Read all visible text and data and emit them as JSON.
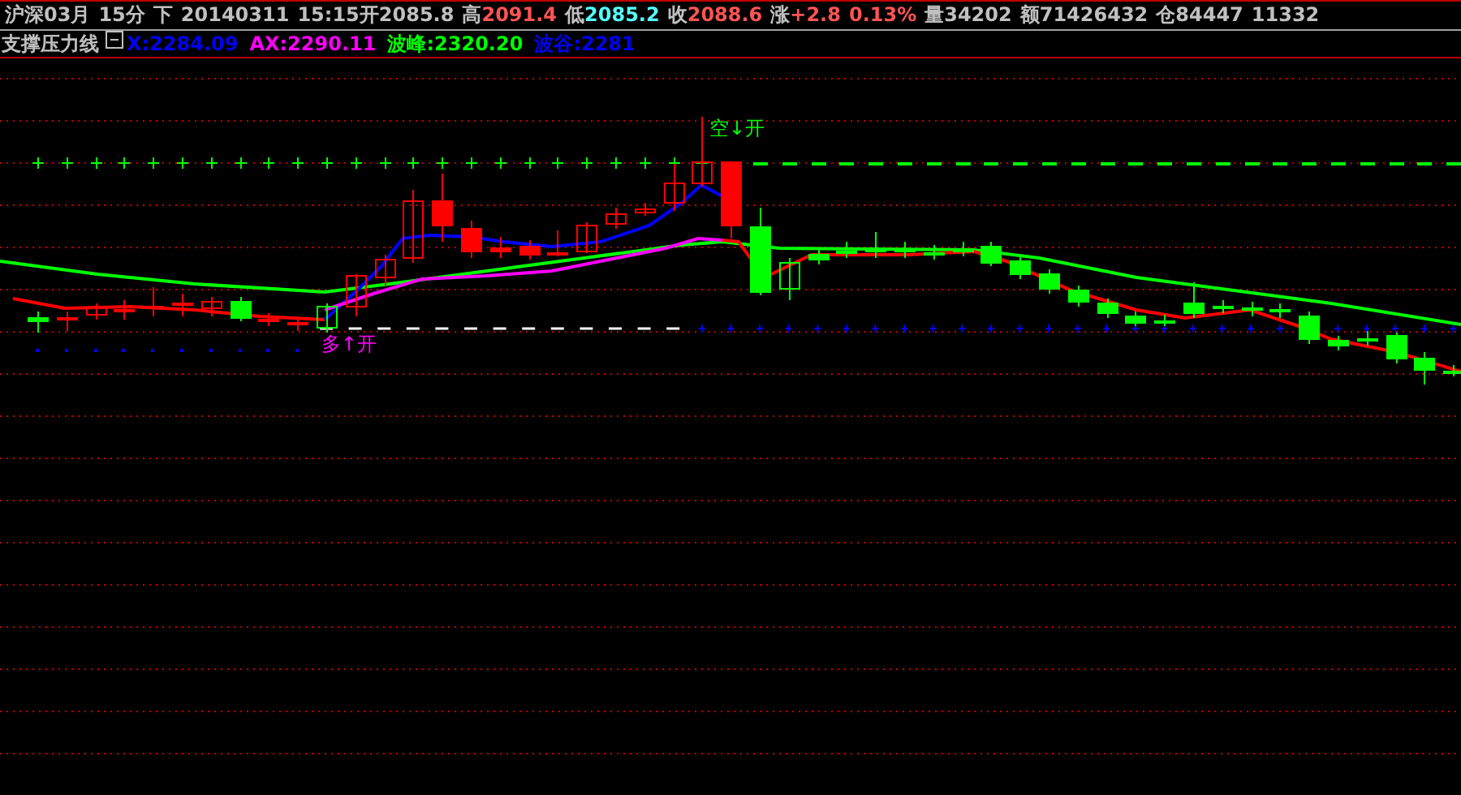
{
  "quote_bar": {
    "info": [
      "沪深03月",
      "15分",
      "下",
      "20140311",
      "15:15开2085.8"
    ],
    "quotes": [
      {
        "label": "高",
        "value": "2091.4",
        "rising": true
      },
      {
        "label": "低",
        "value": "2085.2",
        "rising": false
      },
      {
        "label": "收",
        "value": "2088.6",
        "rising": true
      },
      {
        "label": "涨",
        "value": "+2.8",
        "rising": true
      }
    ],
    "change": {
      "value": "0.13%",
      "rising": true
    },
    "extra": [
      "量34202",
      "额71426432",
      "仓84447",
      "11332"
    ]
  },
  "indicator": {
    "title": "支撑压力线",
    "collapsed": false,
    "series": [
      {
        "text": "X:2284.09"
      },
      {
        "text": "AX:2290.11"
      },
      {
        "text": "波峰:2320.20"
      },
      {
        "text": "波谷:2281"
      }
    ]
  },
  "chart": {
    "signals": [
      {
        "text": "空↓开",
        "kind": "short"
      },
      {
        "text": "多↑开",
        "kind": "long"
      }
    ]
  }
}
